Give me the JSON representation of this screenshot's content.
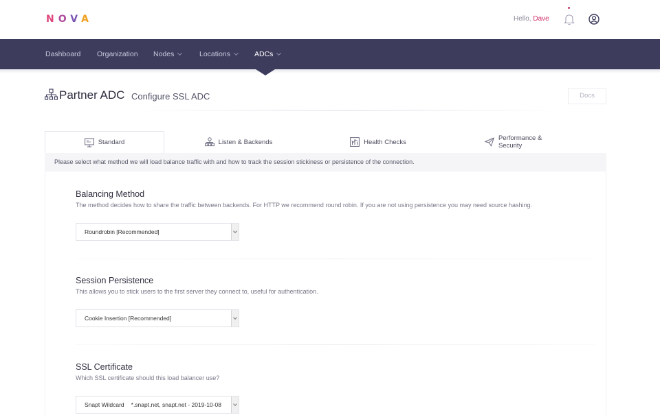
{
  "header": {
    "logo_letters": [
      "N",
      "O",
      "V",
      "A"
    ],
    "greeting": "Hello,",
    "username": "Dave"
  },
  "nav": {
    "items": [
      {
        "label": "Dashboard",
        "has_dropdown": false
      },
      {
        "label": "Organization",
        "has_dropdown": false
      },
      {
        "label": "Nodes",
        "has_dropdown": true
      },
      {
        "label": "Locations",
        "has_dropdown": true
      },
      {
        "label": "ADCs",
        "has_dropdown": true,
        "active": true
      }
    ]
  },
  "page": {
    "title": "Partner ADC",
    "subtitle": "Configure SSL ADC",
    "docs_label": "Docs"
  },
  "tabs": [
    {
      "label": "Standard",
      "icon": "monitor-icon",
      "active": true
    },
    {
      "label": "Listen & Backends",
      "icon": "network-icon",
      "active": false
    },
    {
      "label": "Health Checks",
      "icon": "chart-icon",
      "active": false
    },
    {
      "label": "Performance & Security",
      "icon": "paper-plane-icon",
      "active": false
    }
  ],
  "tab_description": "Please select what method we will load balance traffic with and how to track the session stickiness or persistence of the connection.",
  "sections": {
    "balancing": {
      "title": "Balancing Method",
      "description": "The method decides how to share the traffic between backends. For HTTP we recommend round robin. If you are not using persistence you may need source hashing.",
      "selected": "Roundrobin [Recommended]"
    },
    "persistence": {
      "title": "Session Persistence",
      "description": "This allows you to stick users to the first server they connect to, useful for authentication.",
      "selected": "Cookie Insertion [Recommended]"
    },
    "ssl": {
      "title": "SSL Certificate",
      "description": "Which SSL certificate should this load balancer use?",
      "selected_name": "Snapt Wildcard",
      "selected_detail": "*.snapt.net, snapt.net - 2019-10-08"
    }
  },
  "colors": {
    "nav_bg": "#3d3c5c",
    "accent": "#d0306a"
  }
}
